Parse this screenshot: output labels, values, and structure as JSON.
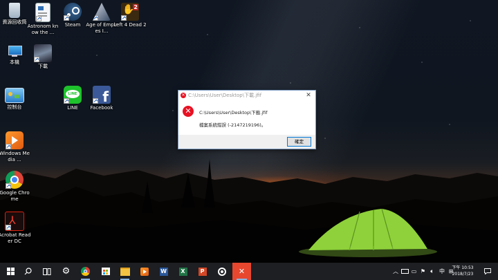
{
  "desktop": {
    "icons": [
      {
        "label": "資源回收筒",
        "icon": "recycle-bin-icon"
      },
      {
        "label": "Astronom know the ...",
        "icon": "document-icon"
      },
      {
        "label": "Steam",
        "icon": "steam-icon"
      },
      {
        "label": "Age of Empires I...",
        "icon": "age-of-empires-icon"
      },
      {
        "label": "Left 4 Dead 2",
        "icon": "left4dead-icon"
      },
      {
        "label": "本機",
        "icon": "this-pc-icon"
      },
      {
        "label": "下載",
        "icon": "robot-image-icon"
      },
      {
        "label": "控制台",
        "icon": "control-panel-icon"
      },
      {
        "label": "LINE",
        "icon": "line-icon"
      },
      {
        "label": "Facebook",
        "icon": "facebook-icon"
      },
      {
        "label": "Windows Media ...",
        "icon": "windows-media-icon"
      },
      {
        "label": "Google Chrome",
        "icon": "chrome-icon"
      },
      {
        "label": "Acrobat Reader DC",
        "icon": "acrobat-icon"
      }
    ]
  },
  "dialog": {
    "title": "C:\\Users\\User\\Desktop\\下載.jfif",
    "path": "C:\\Users\\User\\Desktop\\下載.jfif",
    "message": "檔案系統錯誤 (-2147219196)。",
    "ok_label": "確定",
    "close_glyph": "✕"
  },
  "taskbar": {
    "apps": [
      {
        "icon": "windows-start-icon"
      },
      {
        "icon": "search-icon"
      },
      {
        "icon": "task-view-icon"
      },
      {
        "icon": "settings-gear-icon"
      },
      {
        "icon": "chrome-icon"
      },
      {
        "icon": "store-icon"
      },
      {
        "icon": "file-explorer-icon"
      },
      {
        "icon": "media-player-icon"
      },
      {
        "icon": "word-icon"
      },
      {
        "icon": "excel-icon"
      },
      {
        "icon": "powerpoint-icon"
      },
      {
        "icon": "disc-icon"
      },
      {
        "icon": "photos-error-icon"
      }
    ],
    "tray": {
      "input_method": "中",
      "time": "下午 10:53",
      "date": "2018/7/23"
    }
  }
}
